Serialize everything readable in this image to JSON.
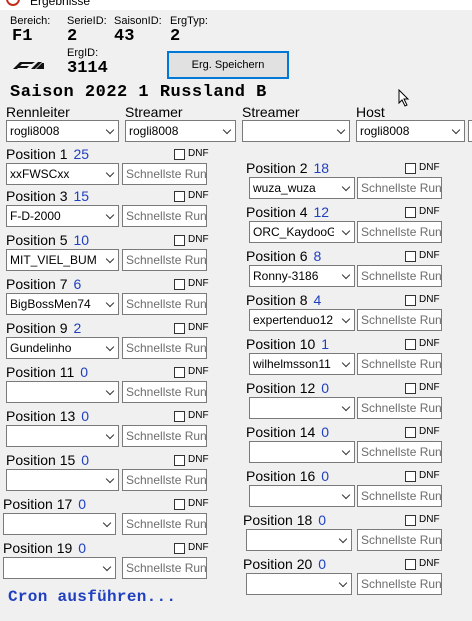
{
  "window": {
    "title": "Ergebnisse"
  },
  "info": {
    "bereich_label": "Bereich:",
    "bereich_value": "F1",
    "serieid_label": "SerieID:",
    "serieid_value": "2",
    "saisonid_label": "SaisonID:",
    "saisonid_value": "43",
    "ergtyp_label": "ErgTyp:",
    "ergtyp_value": "2",
    "ergid_label": "ErgID:",
    "ergid_value": "3114",
    "logo_text": "F1"
  },
  "toolbar": {
    "save_label": "Erg. Speichern"
  },
  "saison_title": "Saison 2022 1 Russland B",
  "roles": [
    {
      "label": "Rennleiter",
      "value": "rogli8008"
    },
    {
      "label": "Streamer",
      "value": "rogli8008"
    },
    {
      "label": "Streamer",
      "value": ""
    },
    {
      "label": "Host",
      "value": "rogli8008"
    }
  ],
  "dnf_label": "DNF",
  "fastest_placeholder": "Schnellste Runde",
  "positions": [
    {
      "label": "Position 1",
      "points": "25",
      "driver": "xxFWSCxx"
    },
    {
      "label": "Position 2",
      "points": "18",
      "driver": "wuza_wuza"
    },
    {
      "label": "Position 3",
      "points": "15",
      "driver": "F-D-2000"
    },
    {
      "label": "Position 4",
      "points": "12",
      "driver": "ORC_KaydooG"
    },
    {
      "label": "Position 5",
      "points": "10",
      "driver": "MIT_VIEL_BUM"
    },
    {
      "label": "Position 6",
      "points": "8",
      "driver": "Ronny-3186"
    },
    {
      "label": "Position 7",
      "points": "6",
      "driver": "BigBossMen74"
    },
    {
      "label": "Position 8",
      "points": "4",
      "driver": "expertenduo12"
    },
    {
      "label": "Position 9",
      "points": "2",
      "driver": "Gundelinho"
    },
    {
      "label": "Position 10",
      "points": "1",
      "driver": "wilhelmsson11"
    },
    {
      "label": "Position 11",
      "points": "0",
      "driver": ""
    },
    {
      "label": "Position 12",
      "points": "0",
      "driver": ""
    },
    {
      "label": "Position 13",
      "points": "0",
      "driver": ""
    },
    {
      "label": "Position 14",
      "points": "0",
      "driver": ""
    },
    {
      "label": "Position 15",
      "points": "0",
      "driver": ""
    },
    {
      "label": "Position 16",
      "points": "0",
      "driver": ""
    },
    {
      "label": "Position 17",
      "points": "0",
      "driver": ""
    },
    {
      "label": "Position 18",
      "points": "0",
      "driver": ""
    },
    {
      "label": "Position 19",
      "points": "0",
      "driver": ""
    },
    {
      "label": "Position 20",
      "points": "0",
      "driver": ""
    }
  ],
  "cron_label": "Cron ausführen...",
  "colors": {
    "accent_blue": "#1f3fbf",
    "focus_border": "#0078d7",
    "error_red": "#c42b1c"
  }
}
